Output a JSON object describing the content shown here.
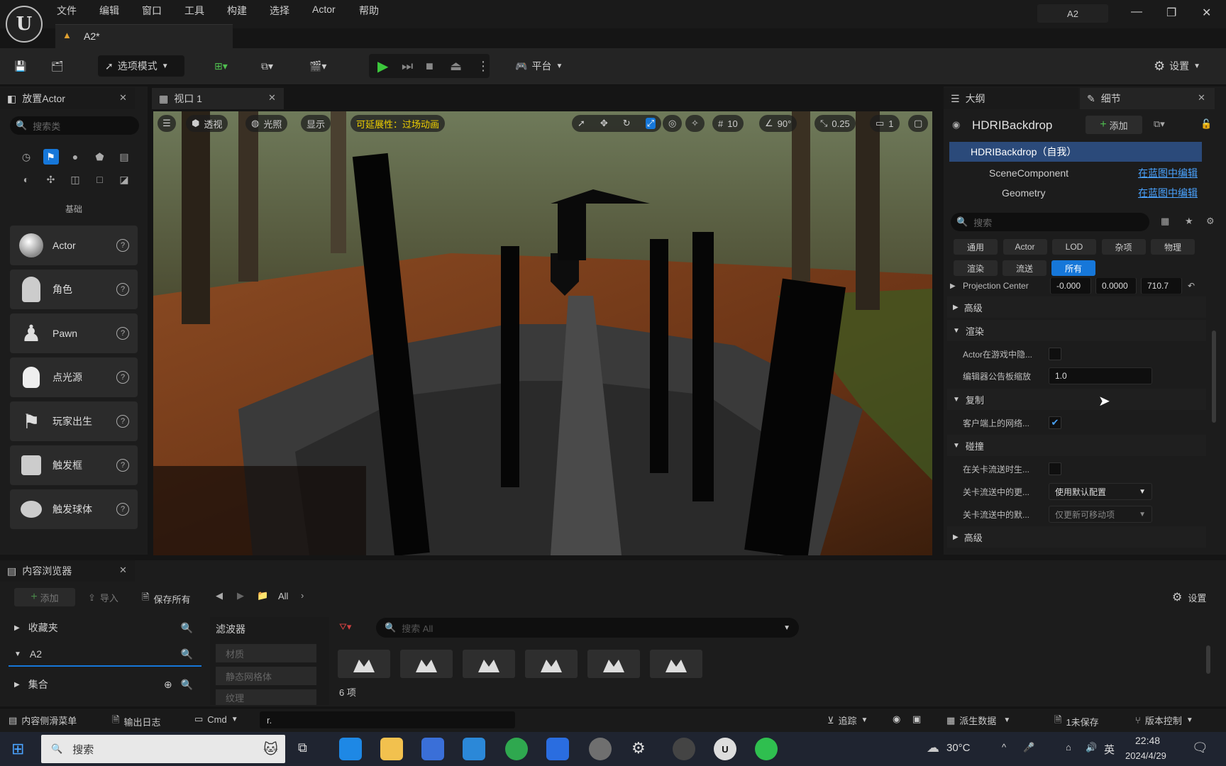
{
  "menubar": {
    "items": [
      "文件",
      "编辑",
      "窗口",
      "工具",
      "构建",
      "选择",
      "Actor",
      "帮助"
    ],
    "project": "A2"
  },
  "doc_tab": "A2*",
  "toolbar": {
    "mode": "选项模式",
    "platform": "平台",
    "settings": "设置"
  },
  "place_actor": {
    "title": "放置Actor",
    "search_placeholder": "搜索类",
    "category": "基础",
    "items": [
      "Actor",
      "角色",
      "Pawn",
      "点光源",
      "玩家出生",
      "触发框",
      "触发球体"
    ]
  },
  "viewport": {
    "tab": "视口 1",
    "perspective": "透视",
    "lit": "光照",
    "show": "显示",
    "scalability": "可延展性：过场动画",
    "grid": "10",
    "angle": "90°",
    "scale": "0.25",
    "camera": "1"
  },
  "outliner": {
    "title": "大纲"
  },
  "details": {
    "title": "细节",
    "object": "HDRIBackdrop",
    "add": "添加",
    "tree": [
      {
        "label": "HDRIBackdrop（自我）",
        "link": ""
      },
      {
        "label": "SceneComponent",
        "link": "在蓝图中编辑"
      },
      {
        "label": "Geometry",
        "link": "在蓝图中编辑"
      }
    ],
    "search_placeholder": "搜索",
    "filters_row1": [
      "通用",
      "Actor",
      "LOD",
      "杂项",
      "物理"
    ],
    "filters_row2": [
      "渲染",
      "流送",
      "所有"
    ],
    "projection": {
      "label": "Projection Center",
      "values": [
        "-0.000",
        "0.0000",
        "710.7"
      ]
    },
    "sections": {
      "advanced": "高级",
      "render": "渲染",
      "replication": "复制",
      "collision": "碰撞",
      "advanced2": "高级"
    },
    "props": {
      "hidden_in_game": "Actor在游戏中隐...",
      "billboard_scale": "编辑器公告板缩放",
      "billboard_value": "1.0",
      "net_load": "客户端上的网络...",
      "stream_gen": "在关卡流送时生...",
      "stream_update": "关卡流送中的更...",
      "stream_update_value": "使用默认配置",
      "stream_default": "关卡流送中的默...",
      "stream_default_value": "仅更新可移动项"
    }
  },
  "content_browser": {
    "title": "内容浏览器",
    "add": "添加",
    "import": "导入",
    "save_all": "保存所有",
    "path": "All",
    "settings": "设置",
    "favorites": "收藏夹",
    "folder": "A2",
    "collections": "集合",
    "filters_title": "滤波器",
    "filters": [
      "材质",
      "静态网格体",
      "纹理"
    ],
    "search_placeholder": "搜索 All",
    "count": "6 项"
  },
  "statusbar": {
    "drawer": "内容侧滑菜单",
    "log": "输出日志",
    "cmd": "Cmd",
    "console": "r.",
    "trace": "追踪",
    "derived": "派生数据",
    "unsaved": "1未保存",
    "vcs": "版本控制"
  },
  "taskbar": {
    "search": "搜索",
    "weather": "30°C",
    "ime": "英",
    "time": "22:48",
    "date": "2024/4/29"
  }
}
